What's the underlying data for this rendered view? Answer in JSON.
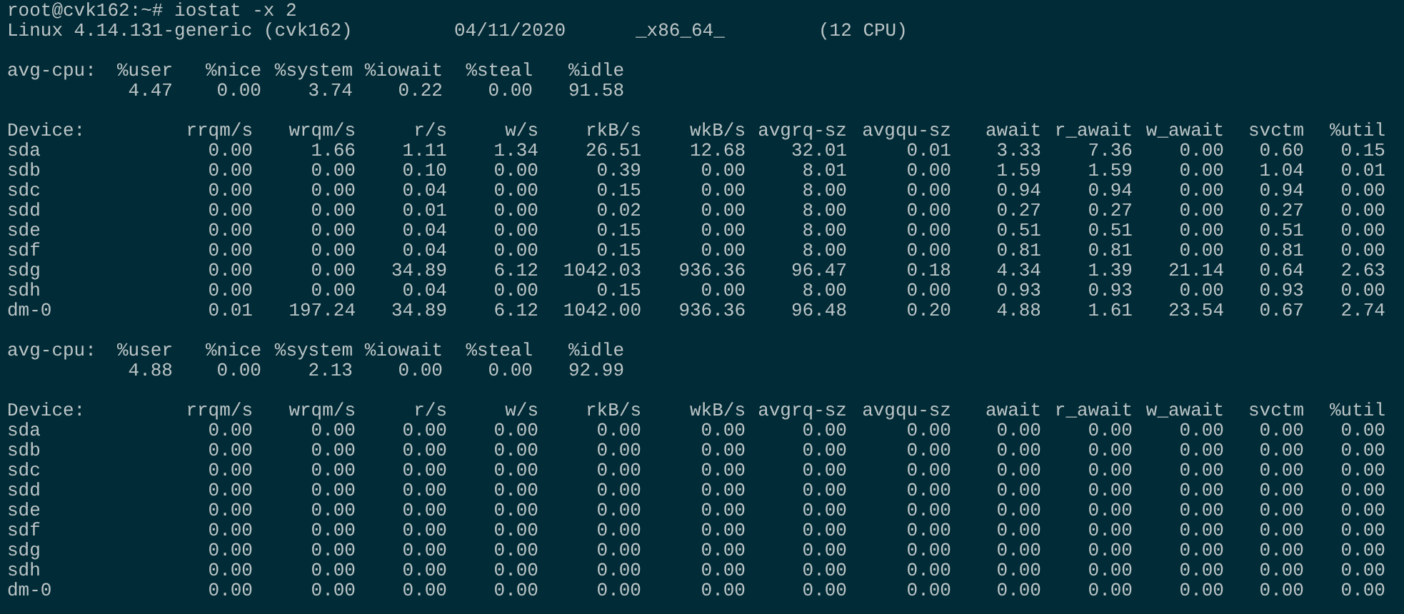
{
  "prompt": "root@cvk162:~# iostat -x 2",
  "system_info": [
    "Linux 4.14.131-generic (cvk162)",
    "04/11/2020",
    "_x86_64_",
    "(12 CPU)"
  ],
  "reports": [
    {
      "cpu": {
        "label": "avg-cpu:",
        "columns": [
          "%user",
          "%nice",
          "%system",
          "%iowait",
          "%steal",
          "%idle"
        ],
        "values": [
          "4.47",
          "0.00",
          "3.74",
          "0.22",
          "0.00",
          "91.58"
        ]
      },
      "devices": {
        "label": "Device:",
        "columns": [
          "rrqm/s",
          "wrqm/s",
          "r/s",
          "w/s",
          "rkB/s",
          "wkB/s",
          "avgrq-sz",
          "avgqu-sz",
          "await",
          "r_await",
          "w_await",
          "svctm",
          "%util"
        ],
        "rows": [
          {
            "device": "sda",
            "values": [
              "0.00",
              "1.66",
              "1.11",
              "1.34",
              "26.51",
              "12.68",
              "32.01",
              "0.01",
              "3.33",
              "7.36",
              "0.00",
              "0.60",
              "0.15"
            ]
          },
          {
            "device": "sdb",
            "values": [
              "0.00",
              "0.00",
              "0.10",
              "0.00",
              "0.39",
              "0.00",
              "8.01",
              "0.00",
              "1.59",
              "1.59",
              "0.00",
              "1.04",
              "0.01"
            ]
          },
          {
            "device": "sdc",
            "values": [
              "0.00",
              "0.00",
              "0.04",
              "0.00",
              "0.15",
              "0.00",
              "8.00",
              "0.00",
              "0.94",
              "0.94",
              "0.00",
              "0.94",
              "0.00"
            ]
          },
          {
            "device": "sdd",
            "values": [
              "0.00",
              "0.00",
              "0.01",
              "0.00",
              "0.02",
              "0.00",
              "8.00",
              "0.00",
              "0.27",
              "0.27",
              "0.00",
              "0.27",
              "0.00"
            ]
          },
          {
            "device": "sde",
            "values": [
              "0.00",
              "0.00",
              "0.04",
              "0.00",
              "0.15",
              "0.00",
              "8.00",
              "0.00",
              "0.51",
              "0.51",
              "0.00",
              "0.51",
              "0.00"
            ]
          },
          {
            "device": "sdf",
            "values": [
              "0.00",
              "0.00",
              "0.04",
              "0.00",
              "0.15",
              "0.00",
              "8.00",
              "0.00",
              "0.81",
              "0.81",
              "0.00",
              "0.81",
              "0.00"
            ]
          },
          {
            "device": "sdg",
            "values": [
              "0.00",
              "0.00",
              "34.89",
              "6.12",
              "1042.03",
              "936.36",
              "96.47",
              "0.18",
              "4.34",
              "1.39",
              "21.14",
              "0.64",
              "2.63"
            ]
          },
          {
            "device": "sdh",
            "values": [
              "0.00",
              "0.00",
              "0.04",
              "0.00",
              "0.15",
              "0.00",
              "8.00",
              "0.00",
              "0.93",
              "0.93",
              "0.00",
              "0.93",
              "0.00"
            ]
          },
          {
            "device": "dm-0",
            "values": [
              "0.01",
              "197.24",
              "34.89",
              "6.12",
              "1042.00",
              "936.36",
              "96.48",
              "0.20",
              "4.88",
              "1.61",
              "23.54",
              "0.67",
              "2.74"
            ]
          }
        ]
      }
    },
    {
      "cpu": {
        "label": "avg-cpu:",
        "columns": [
          "%user",
          "%nice",
          "%system",
          "%iowait",
          "%steal",
          "%idle"
        ],
        "values": [
          "4.88",
          "0.00",
          "2.13",
          "0.00",
          "0.00",
          "92.99"
        ]
      },
      "devices": {
        "label": "Device:",
        "columns": [
          "rrqm/s",
          "wrqm/s",
          "r/s",
          "w/s",
          "rkB/s",
          "wkB/s",
          "avgrq-sz",
          "avgqu-sz",
          "await",
          "r_await",
          "w_await",
          "svctm",
          "%util"
        ],
        "rows": [
          {
            "device": "sda",
            "values": [
              "0.00",
              "0.00",
              "0.00",
              "0.00",
              "0.00",
              "0.00",
              "0.00",
              "0.00",
              "0.00",
              "0.00",
              "0.00",
              "0.00",
              "0.00"
            ]
          },
          {
            "device": "sdb",
            "values": [
              "0.00",
              "0.00",
              "0.00",
              "0.00",
              "0.00",
              "0.00",
              "0.00",
              "0.00",
              "0.00",
              "0.00",
              "0.00",
              "0.00",
              "0.00"
            ]
          },
          {
            "device": "sdc",
            "values": [
              "0.00",
              "0.00",
              "0.00",
              "0.00",
              "0.00",
              "0.00",
              "0.00",
              "0.00",
              "0.00",
              "0.00",
              "0.00",
              "0.00",
              "0.00"
            ]
          },
          {
            "device": "sdd",
            "values": [
              "0.00",
              "0.00",
              "0.00",
              "0.00",
              "0.00",
              "0.00",
              "0.00",
              "0.00",
              "0.00",
              "0.00",
              "0.00",
              "0.00",
              "0.00"
            ]
          },
          {
            "device": "sde",
            "values": [
              "0.00",
              "0.00",
              "0.00",
              "0.00",
              "0.00",
              "0.00",
              "0.00",
              "0.00",
              "0.00",
              "0.00",
              "0.00",
              "0.00",
              "0.00"
            ]
          },
          {
            "device": "sdf",
            "values": [
              "0.00",
              "0.00",
              "0.00",
              "0.00",
              "0.00",
              "0.00",
              "0.00",
              "0.00",
              "0.00",
              "0.00",
              "0.00",
              "0.00",
              "0.00"
            ]
          },
          {
            "device": "sdg",
            "values": [
              "0.00",
              "0.00",
              "0.00",
              "0.00",
              "0.00",
              "0.00",
              "0.00",
              "0.00",
              "0.00",
              "0.00",
              "0.00",
              "0.00",
              "0.00"
            ]
          },
          {
            "device": "sdh",
            "values": [
              "0.00",
              "0.00",
              "0.00",
              "0.00",
              "0.00",
              "0.00",
              "0.00",
              "0.00",
              "0.00",
              "0.00",
              "0.00",
              "0.00",
              "0.00"
            ]
          },
          {
            "device": "dm-0",
            "values": [
              "0.00",
              "0.00",
              "0.00",
              "0.00",
              "0.00",
              "0.00",
              "0.00",
              "0.00",
              "0.00",
              "0.00",
              "0.00",
              "0.00",
              "0.00"
            ]
          }
        ]
      }
    }
  ]
}
